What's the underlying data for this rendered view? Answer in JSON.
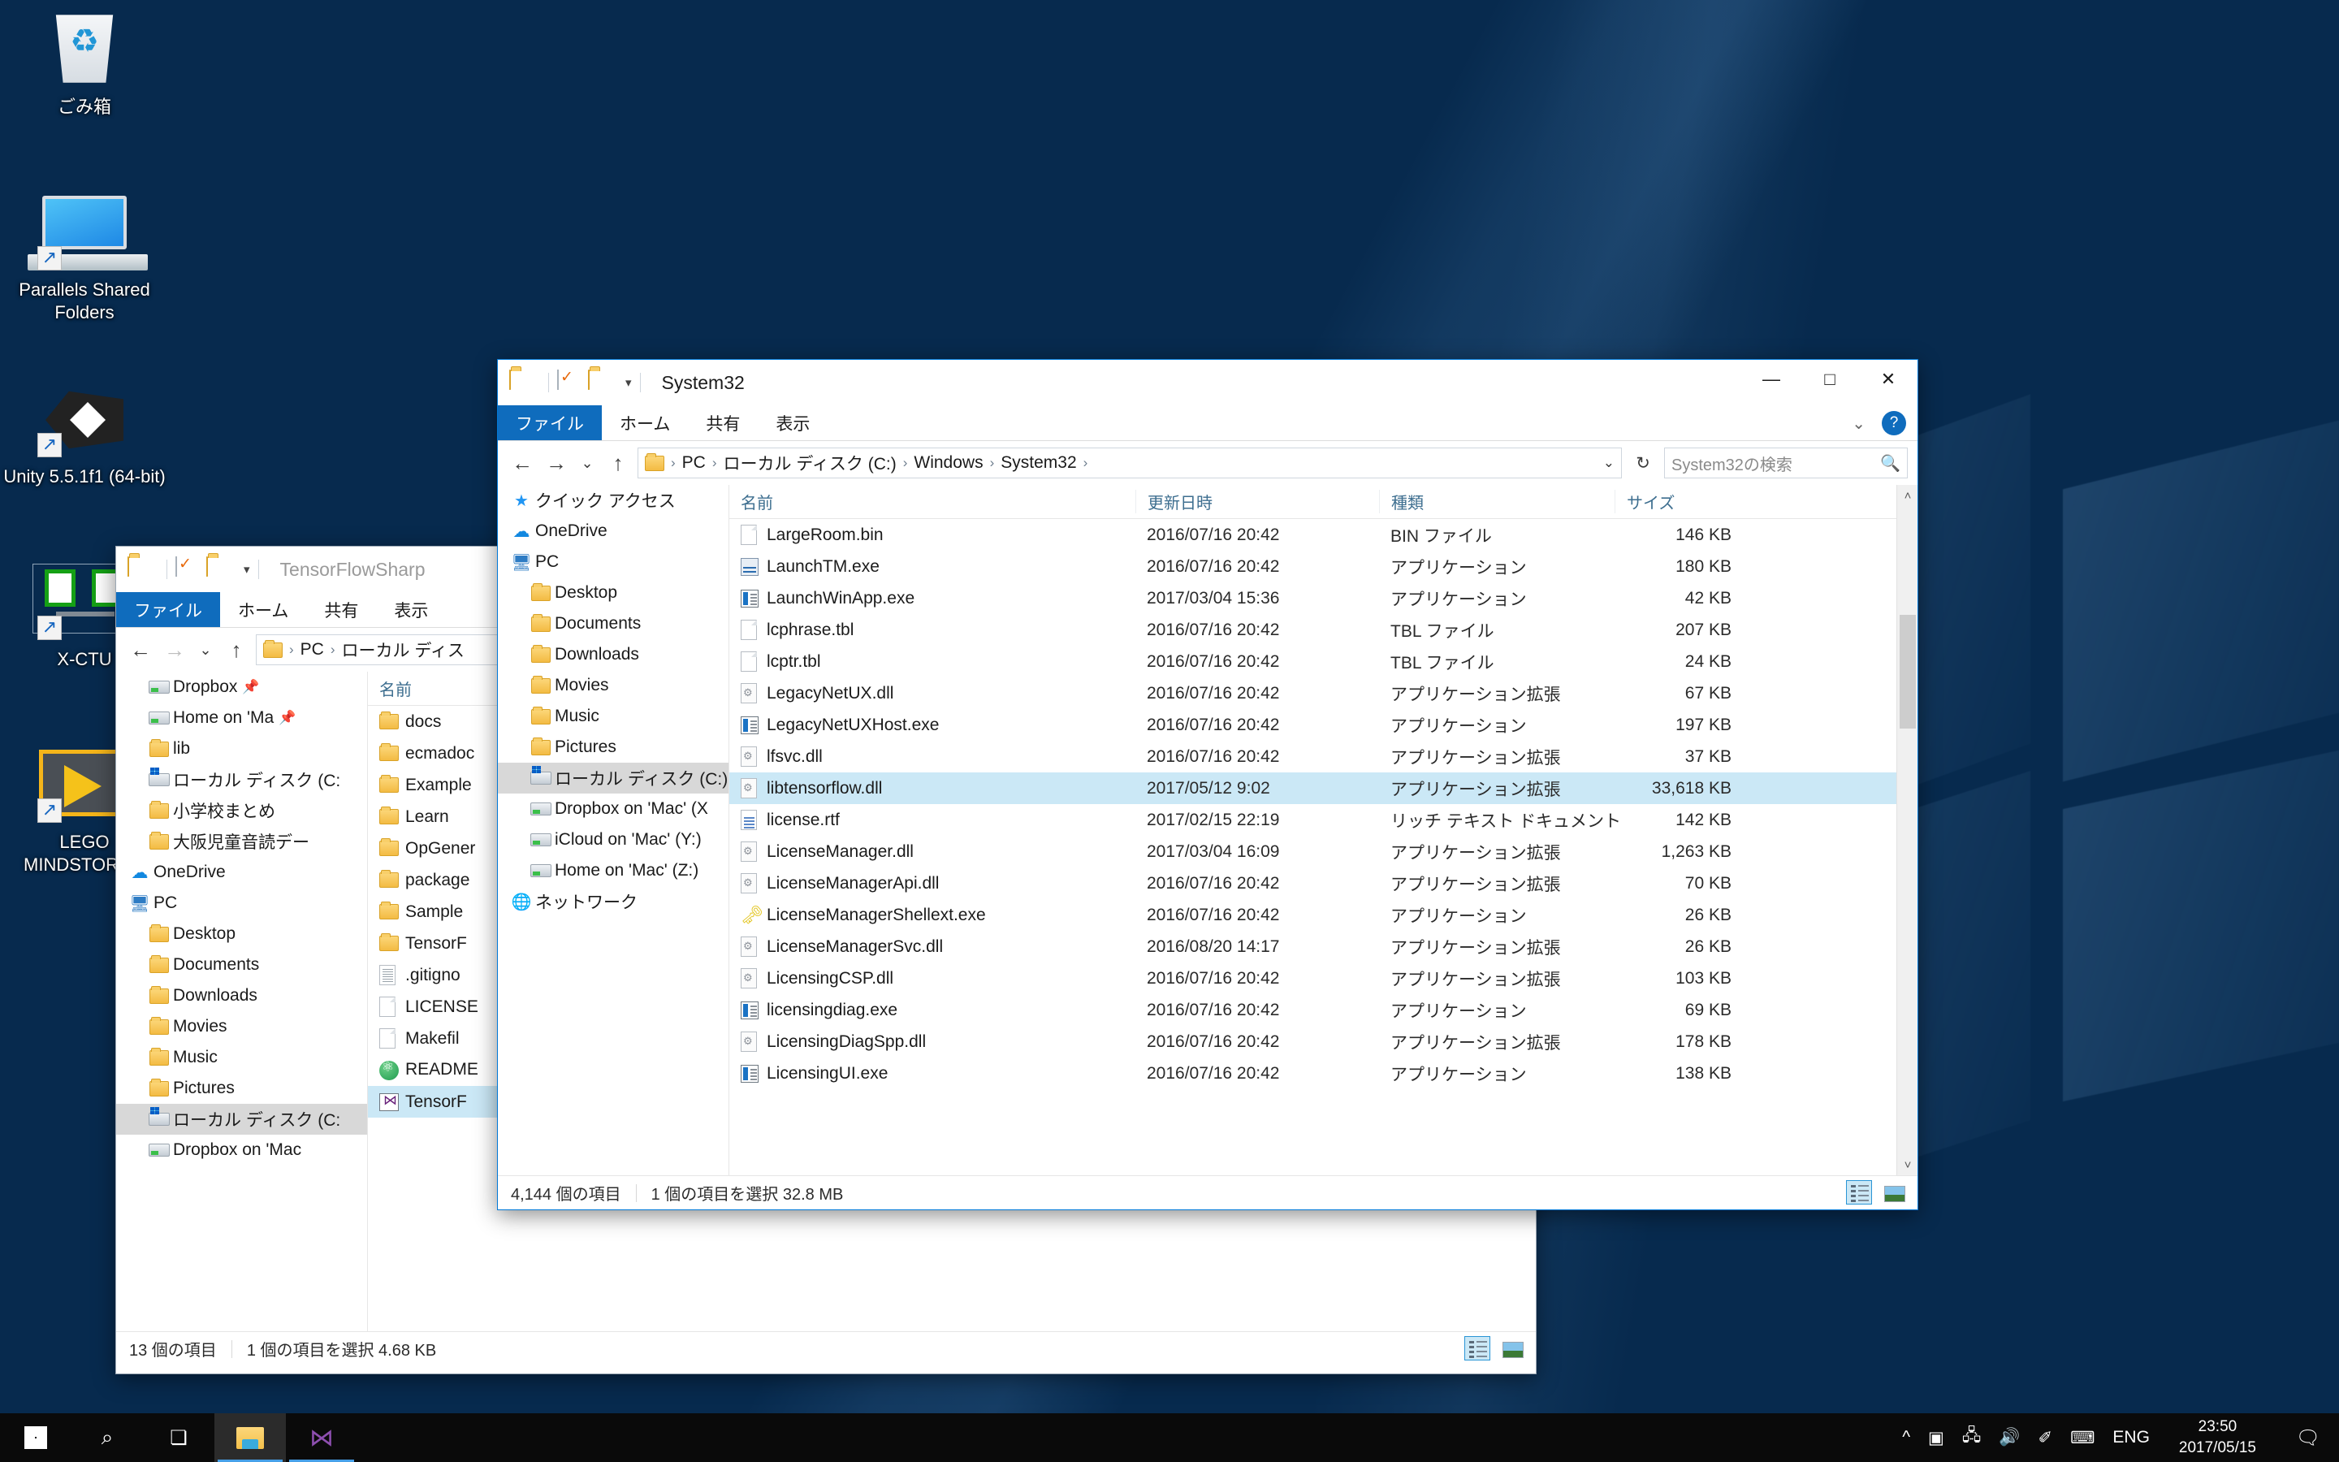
{
  "desktop": {
    "icons": [
      {
        "label": "ごみ箱",
        "icon": "recycle-bin-icon",
        "shortcut": false
      },
      {
        "label": "Parallels Shared Folders",
        "icon": "monitor-icon",
        "shortcut": true
      },
      {
        "label": "Unity 5.5.1f1 (64-bit)",
        "icon": "unity-icon",
        "shortcut": true
      },
      {
        "label": "X-CTU",
        "icon": "xctu-icon",
        "shortcut": true
      },
      {
        "label": "LEGO MINDSTORMS",
        "icon": "lego-mindstorms-icon",
        "shortcut": true
      }
    ]
  },
  "back_window": {
    "title": "TensorFlowSharp",
    "quick_access_icons": [
      "folder-icon",
      "properties-icon",
      "new-folder-icon",
      "chevron-down-icon"
    ],
    "ribbon_tabs": [
      "ファイル",
      "ホーム",
      "共有",
      "表示"
    ],
    "breadcrumbs": [
      "PC",
      "ローカル ディス"
    ],
    "nav_items": [
      {
        "label": "Dropbox",
        "icon": "drive-icon",
        "indent": 1,
        "pinned": true,
        "selected": false
      },
      {
        "label": "Home on 'Ma",
        "icon": "drive-icon",
        "indent": 1,
        "pinned": true,
        "selected": false
      },
      {
        "label": "lib",
        "icon": "folder-icon",
        "indent": 1,
        "pinned": false,
        "selected": false
      },
      {
        "label": "ローカル ディスク (C:",
        "icon": "windows-drive-icon",
        "indent": 1,
        "pinned": false,
        "selected": false
      },
      {
        "label": "小学校まとめ",
        "icon": "folder-icon",
        "indent": 1,
        "pinned": false,
        "selected": false
      },
      {
        "label": "大阪児童音読デー",
        "icon": "folder-icon",
        "indent": 1,
        "pinned": false,
        "selected": false
      },
      {
        "label": "OneDrive",
        "icon": "onedrive-icon",
        "indent": 0,
        "pinned": false,
        "selected": false
      },
      {
        "label": "PC",
        "icon": "pc-icon",
        "indent": 0,
        "pinned": false,
        "selected": false
      },
      {
        "label": "Desktop",
        "icon": "folder-desktop-icon",
        "indent": 1,
        "pinned": false,
        "selected": false
      },
      {
        "label": "Documents",
        "icon": "folder-documents-icon",
        "indent": 1,
        "pinned": false,
        "selected": false
      },
      {
        "label": "Downloads",
        "icon": "folder-downloads-icon",
        "indent": 1,
        "pinned": false,
        "selected": false
      },
      {
        "label": "Movies",
        "icon": "folder-movies-icon",
        "indent": 1,
        "pinned": false,
        "selected": false
      },
      {
        "label": "Music",
        "icon": "folder-music-icon",
        "indent": 1,
        "pinned": false,
        "selected": false
      },
      {
        "label": "Pictures",
        "icon": "folder-pictures-icon",
        "indent": 1,
        "pinned": false,
        "selected": false
      },
      {
        "label": "ローカル ディスク (C:",
        "icon": "windows-drive-icon",
        "indent": 1,
        "pinned": false,
        "selected": true
      },
      {
        "label": "Dropbox on 'Mac",
        "icon": "drive-icon",
        "indent": 1,
        "pinned": false,
        "selected": false
      }
    ],
    "column_header_name": "名前",
    "files": [
      {
        "name": "docs",
        "icon": "folder-icon"
      },
      {
        "name": "ecmadoc",
        "icon": "folder-icon"
      },
      {
        "name": "Example",
        "icon": "folder-icon"
      },
      {
        "name": "Learn",
        "icon": "folder-icon"
      },
      {
        "name": "OpGener",
        "icon": "folder-icon"
      },
      {
        "name": "package",
        "icon": "folder-icon"
      },
      {
        "name": "Sample",
        "icon": "folder-icon"
      },
      {
        "name": "TensorF",
        "icon": "folder-icon"
      },
      {
        "name": ".gitigno",
        "icon": "text-file-icon"
      },
      {
        "name": "LICENSE",
        "icon": "generic-file-icon"
      },
      {
        "name": "Makefil",
        "icon": "generic-file-icon"
      },
      {
        "name": "README",
        "icon": "atom-file-icon"
      },
      {
        "name": "TensorF",
        "icon": "visualstudio-file-icon"
      }
    ],
    "status": {
      "count": "13 個の項目",
      "selection": "1 個の項目を選択  4.68 KB"
    }
  },
  "front_window": {
    "title": "System32",
    "quick_access_icons": [
      "folder-icon",
      "properties-icon",
      "new-folder-icon",
      "chevron-down-icon"
    ],
    "window_buttons": {
      "minimize": "—",
      "maximize": "□",
      "close": "✕"
    },
    "ribbon_tabs": [
      "ファイル",
      "ホーム",
      "共有",
      "表示"
    ],
    "ribbon_right": {
      "collapse": "⌄",
      "help": "?"
    },
    "breadcrumbs": [
      "PC",
      "ローカル ディスク (C:)",
      "Windows",
      "System32"
    ],
    "search": {
      "placeholder": "System32の検索",
      "icon": "search-icon"
    },
    "nav_items": [
      {
        "label": "クイック アクセス",
        "icon": "quick-access-icon",
        "indent": 0,
        "selected": false
      },
      {
        "label": "OneDrive",
        "icon": "onedrive-icon",
        "indent": 0,
        "selected": false
      },
      {
        "label": "PC",
        "icon": "pc-icon",
        "indent": 0,
        "selected": false
      },
      {
        "label": "Desktop",
        "icon": "folder-desktop-icon",
        "indent": 1,
        "selected": false
      },
      {
        "label": "Documents",
        "icon": "folder-documents-icon",
        "indent": 1,
        "selected": false
      },
      {
        "label": "Downloads",
        "icon": "folder-downloads-icon",
        "indent": 1,
        "selected": false
      },
      {
        "label": "Movies",
        "icon": "folder-movies-icon",
        "indent": 1,
        "selected": false
      },
      {
        "label": "Music",
        "icon": "folder-music-icon",
        "indent": 1,
        "selected": false
      },
      {
        "label": "Pictures",
        "icon": "folder-pictures-icon",
        "indent": 1,
        "selected": false
      },
      {
        "label": "ローカル ディスク (C:)",
        "icon": "windows-drive-icon",
        "indent": 1,
        "selected": true
      },
      {
        "label": "Dropbox on 'Mac' (X",
        "icon": "drive-icon",
        "indent": 1,
        "selected": false
      },
      {
        "label": "iCloud on 'Mac' (Y:)",
        "icon": "drive-icon",
        "indent": 1,
        "selected": false
      },
      {
        "label": "Home on 'Mac' (Z:)",
        "icon": "drive-icon",
        "indent": 1,
        "selected": false
      },
      {
        "label": "ネットワーク",
        "icon": "network-icon",
        "indent": 0,
        "selected": false
      }
    ],
    "columns": [
      "名前",
      "更新日時",
      "種類",
      "サイズ"
    ],
    "sort_indicator": "^",
    "files": [
      {
        "name": "LargeRoom.bin",
        "date": "2016/07/16 20:42",
        "type": "BIN ファイル",
        "size": "146 KB",
        "icon": "generic-file-icon",
        "selected": false
      },
      {
        "name": "LaunchTM.exe",
        "date": "2016/07/16 20:42",
        "type": "アプリケーション",
        "size": "180 KB",
        "icon": "taskmanager-file-icon",
        "selected": false
      },
      {
        "name": "LaunchWinApp.exe",
        "date": "2017/03/04 15:36",
        "type": "アプリケーション",
        "size": "42 KB",
        "icon": "exe-file-icon",
        "selected": false
      },
      {
        "name": "lcphrase.tbl",
        "date": "2016/07/16 20:42",
        "type": "TBL ファイル",
        "size": "207 KB",
        "icon": "generic-file-icon",
        "selected": false
      },
      {
        "name": "lcptr.tbl",
        "date": "2016/07/16 20:42",
        "type": "TBL ファイル",
        "size": "24 KB",
        "icon": "generic-file-icon",
        "selected": false
      },
      {
        "name": "LegacyNetUX.dll",
        "date": "2016/07/16 20:42",
        "type": "アプリケーション拡張",
        "size": "67 KB",
        "icon": "dll-file-icon",
        "selected": false
      },
      {
        "name": "LegacyNetUXHost.exe",
        "date": "2016/07/16 20:42",
        "type": "アプリケーション",
        "size": "197 KB",
        "icon": "exe-file-icon",
        "selected": false
      },
      {
        "name": "lfsvc.dll",
        "date": "2016/07/16 20:42",
        "type": "アプリケーション拡張",
        "size": "37 KB",
        "icon": "dll-file-icon",
        "selected": false
      },
      {
        "name": "libtensorflow.dll",
        "date": "2017/05/12 9:02",
        "type": "アプリケーション拡張",
        "size": "33,618 KB",
        "icon": "dll-file-icon",
        "selected": true
      },
      {
        "name": "license.rtf",
        "date": "2017/02/15 22:19",
        "type": "リッチ テキスト ドキュメント",
        "size": "142 KB",
        "icon": "rtf-file-icon",
        "selected": false
      },
      {
        "name": "LicenseManager.dll",
        "date": "2017/03/04 16:09",
        "type": "アプリケーション拡張",
        "size": "1,263 KB",
        "icon": "dll-file-icon",
        "selected": false
      },
      {
        "name": "LicenseManagerApi.dll",
        "date": "2016/07/16 20:42",
        "type": "アプリケーション拡張",
        "size": "70 KB",
        "icon": "dll-file-icon",
        "selected": false
      },
      {
        "name": "LicenseManagerShellext.exe",
        "date": "2016/07/16 20:42",
        "type": "アプリケーション",
        "size": "26 KB",
        "icon": "key-file-icon",
        "selected": false
      },
      {
        "name": "LicenseManagerSvc.dll",
        "date": "2016/08/20 14:17",
        "type": "アプリケーション拡張",
        "size": "26 KB",
        "icon": "dll-file-icon",
        "selected": false
      },
      {
        "name": "LicensingCSP.dll",
        "date": "2016/07/16 20:42",
        "type": "アプリケーション拡張",
        "size": "103 KB",
        "icon": "dll-file-icon",
        "selected": false
      },
      {
        "name": "licensingdiag.exe",
        "date": "2016/07/16 20:42",
        "type": "アプリケーション",
        "size": "69 KB",
        "icon": "exe-file-icon",
        "selected": false
      },
      {
        "name": "LicensingDiagSpp.dll",
        "date": "2016/07/16 20:42",
        "type": "アプリケーション拡張",
        "size": "178 KB",
        "icon": "dll-file-icon",
        "selected": false
      },
      {
        "name": "LicensingUI.exe",
        "date": "2016/07/16 20:42",
        "type": "アプリケーション",
        "size": "138 KB",
        "icon": "exe-file-icon",
        "selected": false
      }
    ],
    "status": {
      "count": "4,144 個の項目",
      "selection": "1 個の項目を選択  32.8 MB"
    }
  },
  "taskbar": {
    "start_icon": "windows-start-icon",
    "search_icon": "search-icon",
    "taskview_icon": "task-view-icon",
    "apps": [
      {
        "name": "file-explorer",
        "icon": "folder-icon",
        "running": true
      },
      {
        "name": "visual-studio",
        "icon": "visualstudio-icon",
        "running": true
      }
    ],
    "tray": {
      "overflow": "^",
      "icons": [
        "battery-icon",
        "network-icon",
        "volume-icon",
        "pen-icon",
        "keyboard-icon"
      ],
      "language": "ENG",
      "time": "23:50",
      "date": "2017/05/15",
      "action_center": "notification-icon"
    }
  },
  "colors": {
    "accent": "#0f6cbd",
    "selection": "#cbe8f6",
    "taskbar": "#0a0a0a",
    "desktop": "#072a4e"
  }
}
